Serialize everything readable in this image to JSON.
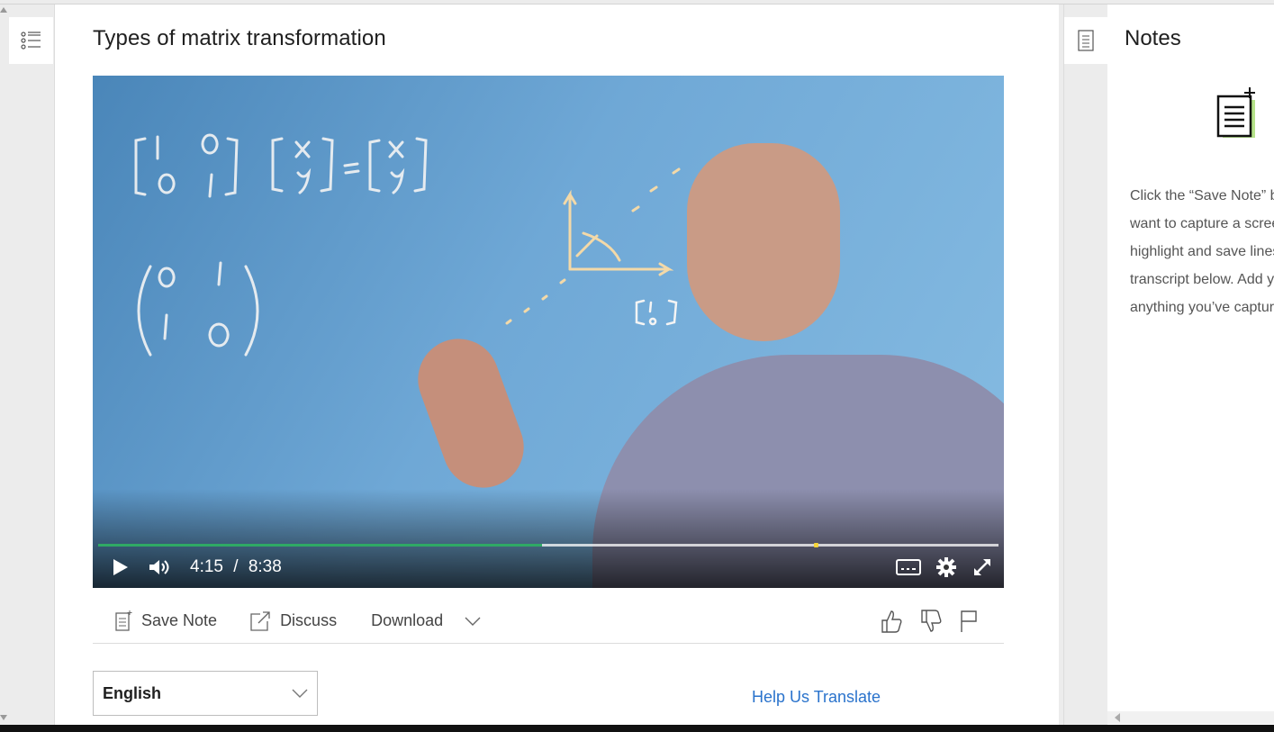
{
  "lesson": {
    "title": "Types of matrix transformation"
  },
  "player": {
    "current_time": "4:15",
    "separator": "/",
    "duration": "8:38",
    "progress_fraction": 0.493,
    "buffered_marker_fraction": 0.795,
    "accent_color": "#2fa965",
    "marker_color": "#f6d53b"
  },
  "toolbar": {
    "save_note_label": "Save Note",
    "discuss_label": "Discuss",
    "download_label": "Download"
  },
  "transcript": {
    "language_selected": "English",
    "help_translate_label": "Help Us Translate"
  },
  "notes": {
    "title": "Notes",
    "lines": [
      "Click the “Save Note” button when you",
      "want to capture a screen. You can also",
      "highlight and save lines from the",
      "transcript below. Add your own notes to",
      "anything you’ve captured."
    ]
  },
  "colors": {
    "link": "#2a73cc",
    "notes_icon_fill": "#b6e38a"
  }
}
